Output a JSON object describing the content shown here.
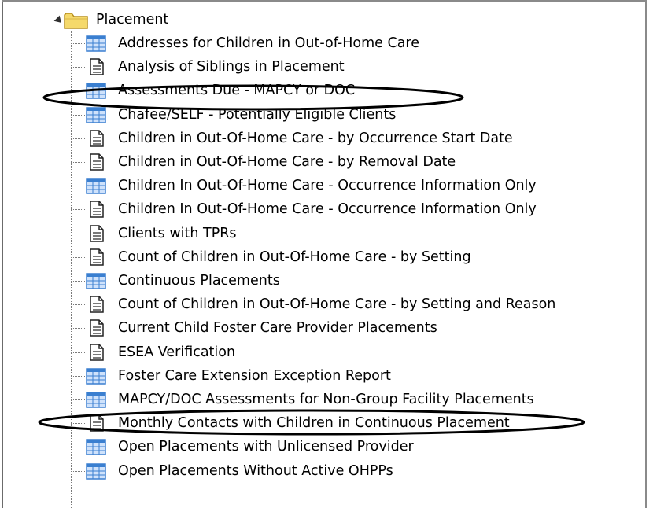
{
  "tree": {
    "root_label": "Placement",
    "items": [
      {
        "label": "Addresses for Children in Out-of-Home Care",
        "icon": "report-grid-icon"
      },
      {
        "label": "Analysis of Siblings in Placement",
        "icon": "document-icon"
      },
      {
        "label": "Assessments Due - MAPCY or DOC",
        "icon": "report-grid-icon"
      },
      {
        "label": "Chafee/SELF - Potentially Eligible Clients",
        "icon": "report-grid-icon"
      },
      {
        "label": "Children in Out-Of-Home Care - by Occurrence Start Date",
        "icon": "document-icon"
      },
      {
        "label": "Children in Out-Of-Home Care - by Removal Date",
        "icon": "document-icon"
      },
      {
        "label": "Children In Out-Of-Home Care - Occurrence Information Only",
        "icon": "report-grid-icon"
      },
      {
        "label": "Children In Out-Of-Home Care - Occurrence Information Only",
        "icon": "document-icon"
      },
      {
        "label": "Clients with TPRs",
        "icon": "document-icon"
      },
      {
        "label": "Count of Children in Out-Of-Home Care - by Setting",
        "icon": "document-icon"
      },
      {
        "label": "Continuous Placements",
        "icon": "report-grid-icon"
      },
      {
        "label": "Count of Children in Out-Of-Home Care - by Setting and Reason",
        "icon": "document-icon"
      },
      {
        "label": "Current Child Foster Care Provider Placements",
        "icon": "document-icon"
      },
      {
        "label": "ESEA Verification",
        "icon": "document-icon"
      },
      {
        "label": "Foster Care Extension Exception Report",
        "icon": "report-grid-icon"
      },
      {
        "label": "MAPCY/DOC Assessments for Non-Group Facility Placements",
        "icon": "report-grid-icon"
      },
      {
        "label": "Monthly Contacts with Children in Continuous Placement",
        "icon": "document-icon"
      },
      {
        "label": "Open Placements with Unlicensed Provider",
        "icon": "report-grid-icon"
      },
      {
        "label": "Open Placements Without Active OHPPs",
        "icon": "report-grid-icon"
      }
    ]
  },
  "colors": {
    "grid_icon_blue": "#3a7fd0",
    "grid_icon_light": "#cfe2fb",
    "folder_fill": "#f5d96b",
    "folder_stroke": "#b8901e",
    "highlight_oval": "#000000"
  }
}
